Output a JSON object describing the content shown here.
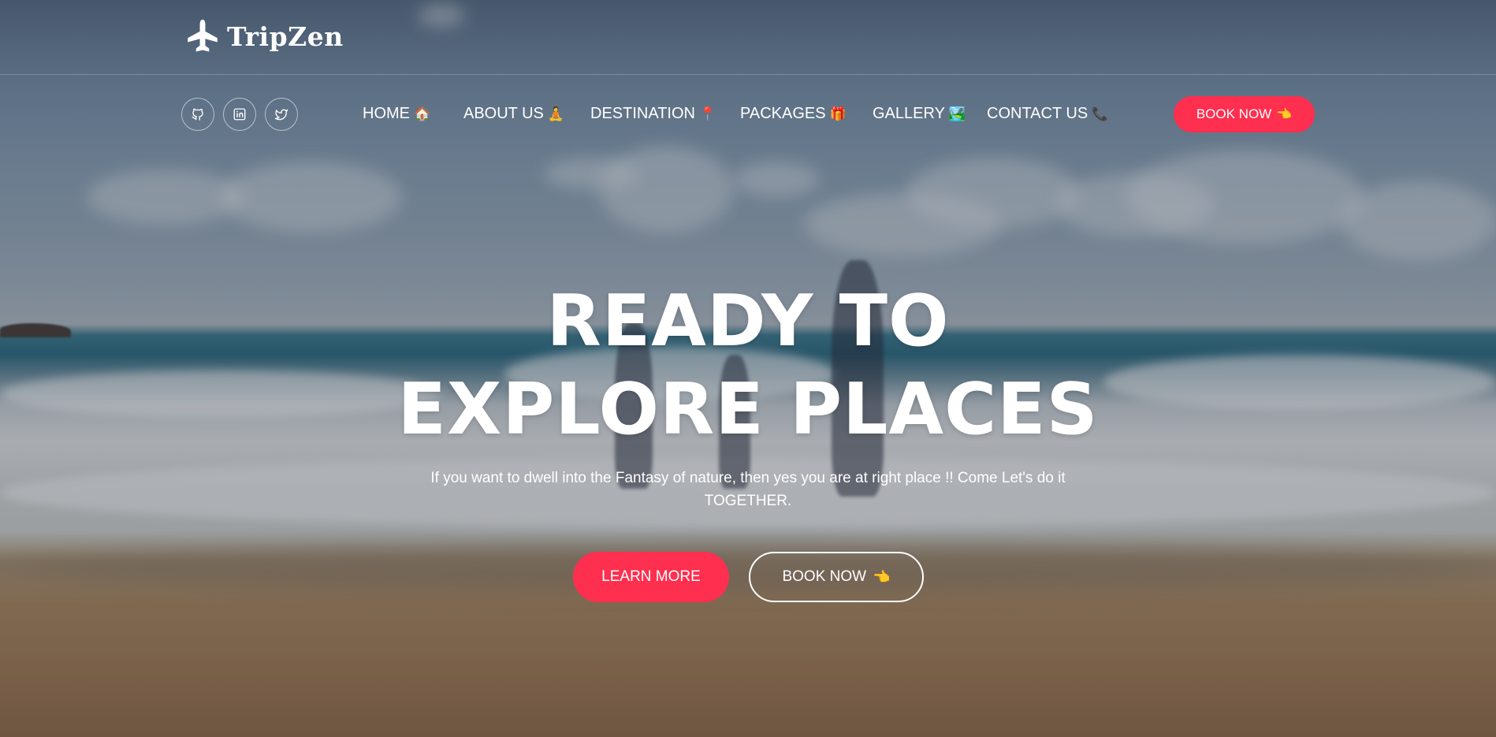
{
  "brand": {
    "name": "TripZen",
    "icon": "airplane-icon"
  },
  "socials": [
    {
      "icon": "github-icon"
    },
    {
      "icon": "linkedin-icon"
    },
    {
      "icon": "twitter-icon"
    }
  ],
  "nav": {
    "items": [
      {
        "label": "HOME",
        "emoji": "🏠"
      },
      {
        "label": "ABOUT US",
        "emoji": "🧘"
      },
      {
        "label": "DESTINATION",
        "emoji": "📍"
      },
      {
        "label": "PACKAGES",
        "emoji": "🎁"
      },
      {
        "label": "GALLERY",
        "emoji": "🏞️"
      },
      {
        "label": "CONTACT US",
        "emoji": "📞"
      }
    ],
    "book_label": "BOOK NOW",
    "book_emoji": "👈"
  },
  "hero": {
    "headline_line1": "READY TO",
    "headline_line2": "EXPLORE PLACES",
    "subtitle": "If you want to dwell into the Fantasy of nature, then yes you are at right place !! Come Let's do it TOGETHER.",
    "learn_more_label": "LEARN MORE",
    "book_label": "BOOK NOW",
    "book_emoji": "👈"
  },
  "colors": {
    "accent": "#fe2f4f",
    "text": "#ffffff"
  }
}
